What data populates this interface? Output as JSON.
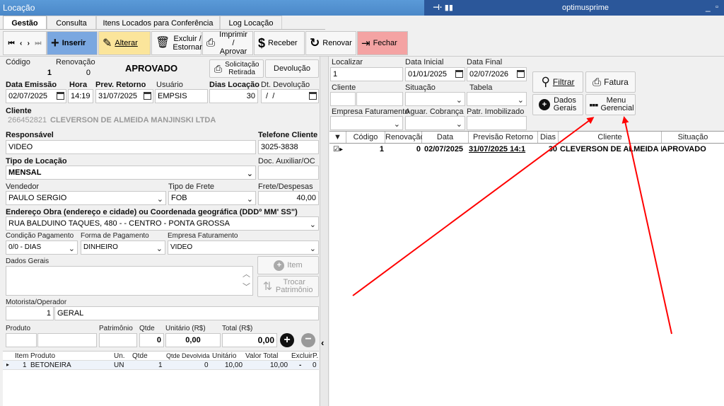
{
  "window": {
    "title": "Locação",
    "user": "optimusprime"
  },
  "tabs": [
    "Gestão",
    "Consulta",
    "Itens Locados para Conferência",
    "Log Locação"
  ],
  "toolbar": {
    "inserir": "Inserir",
    "alterar": "Alterar",
    "excluir": "Excluir / Estornar",
    "imprimir": "Imprimir / Aprovar",
    "receber": "Receber",
    "renovar": "Renovar",
    "fechar": "Fechar"
  },
  "form": {
    "codigo_label": "Código",
    "codigo": "1",
    "renovacao_label": "Renovação",
    "renovacao": "0",
    "status": "APROVADO",
    "solicitacao_label": "Solicitação Retirada",
    "devolucao_btn": "Devolução",
    "data_emissao_label": "Data Emissão",
    "data_emissao": "02/07/2025",
    "hora_label": "Hora",
    "hora": "14:19",
    "prev_retorno_label": "Prev. Retorno",
    "prev_retorno": "31/07/2025",
    "usuario_label": "Usuário",
    "usuario": "EMPSIS",
    "dias_locacao_label": "Dias Locação",
    "dias_locacao": "30",
    "dt_devolucao_label": "Dt. Devolução",
    "dt_devolucao": " /  /",
    "cliente_label": "Cliente",
    "cliente_codigo": "266452821",
    "cliente_nome": "CLEVERSON DE ALMEIDA MANJINSKI LTDA",
    "responsavel_label": "Responsável",
    "responsavel": "VIDEO",
    "telefone_label": "Telefone Cliente",
    "telefone": "3025-3838",
    "tipo_locacao_label": "Tipo de Locação",
    "tipo_locacao": "MENSAL",
    "doc_auxiliar_label": "Doc. Auxiliar/OC",
    "doc_auxiliar": "",
    "vendedor_label": "Vendedor",
    "vendedor": "PAULO SERGIO",
    "tipo_frete_label": "Tipo de Frete",
    "tipo_frete": "FOB",
    "frete_label": "Frete/Despesas",
    "frete": "40,00",
    "endereco_label": "Endereço Obra (endereço e cidade) ou Coordenada geográfica (DDDº MM' SS\")",
    "endereco": "RUA BALDUINO TAQUES, 480 -  - CENTRO - PONTA GROSSA",
    "cond_pag_label": "Condição Pagamento",
    "cond_pag": "0/0 - DIAS",
    "forma_pag_label": "Forma de Pagamento",
    "forma_pag": "DINHEIRO",
    "empresa_fat_label": "Empresa Faturamento",
    "empresa_fat": "VIDEO",
    "dados_gerais_label": "Dados Gerais",
    "item_btn": "Item",
    "trocar_btn": "Trocar Patrimônio",
    "motorista_label": "Motorista/Operador",
    "motorista_cod": "1",
    "motorista": "GERAL",
    "produto_label": "Produto",
    "patrimonio_label": "Patrimônio",
    "qtde_label": "Qtde",
    "qtde": "0",
    "unitario_label": "Unitário (R$)",
    "unitario": "0,00",
    "total_label": "Total (R$)",
    "total": "0,00"
  },
  "items_grid": {
    "headers": [
      "Item",
      "Produto",
      "Un.",
      "Qtde",
      "Qtde Devolvida",
      "Unitário",
      "Valor Total",
      "Excluir",
      "P."
    ],
    "rows": [
      {
        "item": "1",
        "produto": "BETONEIRA",
        "un": "UN",
        "qtde": "1",
        "qtde_dev": "0",
        "unitario": "10,00",
        "total": "10,00",
        "excluir": "-",
        "p": "0"
      }
    ]
  },
  "search": {
    "localizar_label": "Localizar",
    "localizar": "1",
    "data_inicial_label": "Data Inicial",
    "data_inicial": "01/01/2025",
    "data_final_label": "Data Final",
    "data_final": "02/07/2026",
    "cliente_label": "Cliente",
    "situacao_label": "Situação",
    "tabela_label": "Tabela",
    "empresa_label": "Empresa Faturamento",
    "aguar_label": "Aguar. Cobrança",
    "patr_label": "Patr. Imobilizado",
    "filtrar": "Filtrar",
    "fatura": "Fatura",
    "dados_gerais": "Dados Gerais",
    "menu_gerencial": "Menu Gerencial"
  },
  "results_grid": {
    "headers": [
      "Código",
      "Renovação",
      "Data",
      "Previsão Retorno",
      "Dias",
      "Cliente",
      "Situação"
    ],
    "rows": [
      {
        "codigo": "1",
        "renovacao": "0",
        "data": "02/07/2025",
        "previsao": "31/07/2025 14:1",
        "dias": "30",
        "cliente": "CLEVERSON DE ALMEIDA M",
        "situacao": "APROVADO"
      }
    ]
  },
  "colors": {
    "titlebar": "#5b9bd5",
    "inserir_bg": "#7aa7e0",
    "alterar_bg": "#fbe59b",
    "fechar_bg": "#f4a3a3",
    "arrow": "#ff0000"
  },
  "arrows": 2
}
